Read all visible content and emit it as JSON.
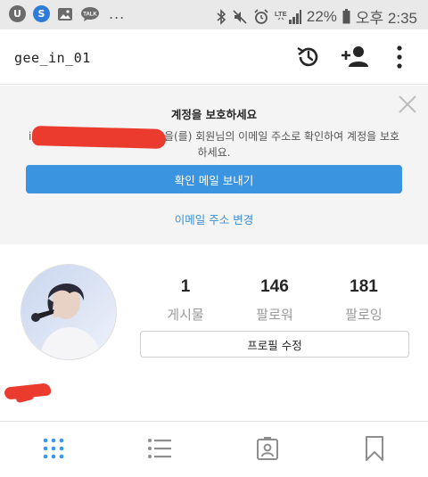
{
  "status_bar": {
    "apps": [
      {
        "icon": "kakao-icon",
        "glyph": "U",
        "color": "#555555"
      },
      {
        "icon": "s-app-icon",
        "glyph": "S",
        "color": "#2f7bd8"
      },
      {
        "icon": "gallery-icon",
        "glyph": "",
        "color": "#555555"
      },
      {
        "icon": "talk-icon",
        "glyph": "TALK",
        "color": "#555555"
      }
    ],
    "more": "...",
    "icons": [
      "bluetooth-icon",
      "mute-icon",
      "alarm-icon",
      "lte-signal-icon"
    ],
    "lte_label": "LTE",
    "battery": "22%",
    "time": "오후 2:35"
  },
  "header": {
    "username": "gee_in_01",
    "icons": [
      "history-icon",
      "add-person-icon",
      "more-vertical-icon"
    ]
  },
  "banner": {
    "title": "계정을 보호하세요",
    "text": "i··· 을(를) 회원님의 이메일 주소로 확인하여 계정을 보호하세요.",
    "text_visible": "을(를) 회원님의 이메일 주소로 확인하여 계정을 보호하세요.",
    "primary_button": "확인 메일 보내기",
    "link": "이메일 주소 변경",
    "accent": "#3a94e0"
  },
  "profile": {
    "stats": [
      {
        "value": "1",
        "label": "게시물"
      },
      {
        "value": "146",
        "label": "팔로워"
      },
      {
        "value": "181",
        "label": "팔로잉"
      }
    ],
    "edit_button": "프로필 수정"
  },
  "tabbar": {
    "tabs": [
      "grid-icon",
      "list-icon",
      "tagged-photo-icon",
      "bookmark-icon"
    ],
    "active_color": "#3897f0"
  }
}
